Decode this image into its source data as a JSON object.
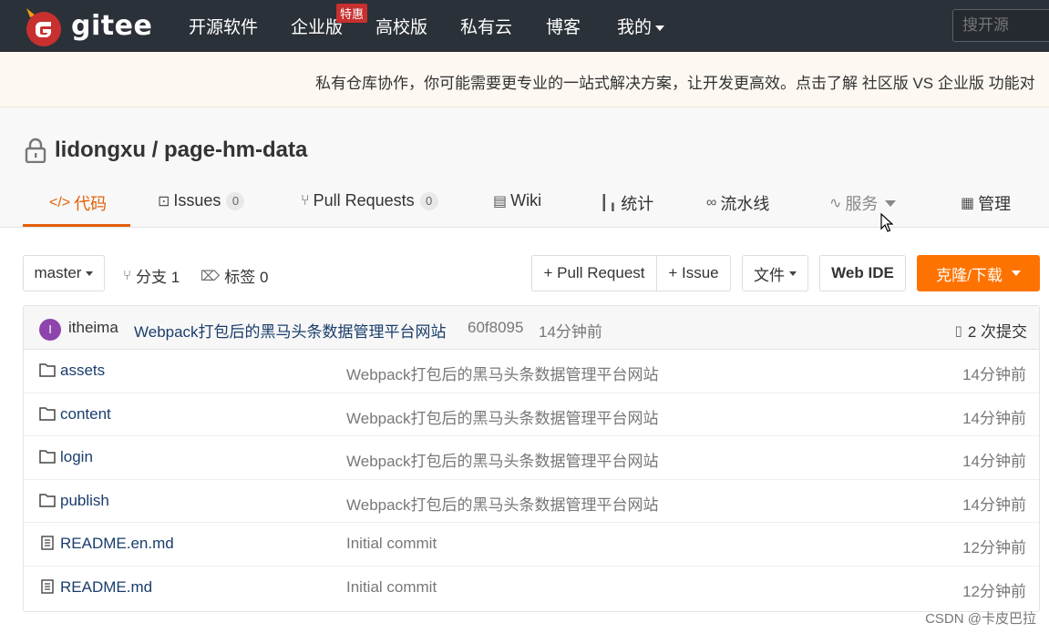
{
  "nav": {
    "logo_text": "gitee",
    "items": [
      "开源软件",
      "企业版",
      "高校版",
      "私有云",
      "博客",
      "我的"
    ],
    "promo_tag": "特惠",
    "search_placeholder": "搜开源",
    "bg_color": "#2b3138"
  },
  "promo": {
    "text": "私有仓库协作，你可能需要更专业的一站式解决方案，让开发更高效。点击了解 社区版 VS 企业版 功能对"
  },
  "repo": {
    "owner": "lidongxu",
    "separator": " / ",
    "name": "page-hm-data",
    "tabs": [
      {
        "label": "代码",
        "icon": "code-icon"
      },
      {
        "label": "Issues",
        "icon": "issues-icon",
        "count": "0"
      },
      {
        "label": "Pull Requests",
        "icon": "pull-request-icon",
        "count": "0"
      },
      {
        "label": "Wiki",
        "icon": "wiki-icon"
      },
      {
        "label": "统计",
        "icon": "chart-icon"
      },
      {
        "label": "流水线",
        "icon": "pipeline-icon"
      },
      {
        "label": "服务",
        "icon": "pulse-icon"
      },
      {
        "label": "管理",
        "icon": "manage-icon"
      }
    ],
    "accent_color": "#e36209"
  },
  "toolbar": {
    "branch": "master",
    "branches": "分支 1",
    "tags": "标签 0",
    "new_pr": "+ Pull Request",
    "new_issue": "+ Issue",
    "file_menu": "文件",
    "web_ide": "Web IDE",
    "clone": "克隆/下载",
    "clone_color": "#fe7300"
  },
  "commit": {
    "avatar_letter": "I",
    "author": "itheima",
    "message": "Webpack打包后的黑马头条数据管理平台网站",
    "hash": "60f8095",
    "time": "14分钟前",
    "count": "2 次提交"
  },
  "files": [
    {
      "name": "assets",
      "type": "folder",
      "message": "Webpack打包后的黑马头条数据管理平台网站",
      "time": "14分钟前"
    },
    {
      "name": "content",
      "type": "folder",
      "message": "Webpack打包后的黑马头条数据管理平台网站",
      "time": "14分钟前"
    },
    {
      "name": "login",
      "type": "folder",
      "message": "Webpack打包后的黑马头条数据管理平台网站",
      "time": "14分钟前"
    },
    {
      "name": "publish",
      "type": "folder",
      "message": "Webpack打包后的黑马头条数据管理平台网站",
      "time": "14分钟前"
    },
    {
      "name": "README.en.md",
      "type": "file",
      "message": "Initial commit",
      "time": "12分钟前"
    },
    {
      "name": "README.md",
      "type": "file",
      "message": "Initial commit",
      "time": "12分钟前"
    }
  ],
  "watermark": "CSDN @卡皮巴拉"
}
